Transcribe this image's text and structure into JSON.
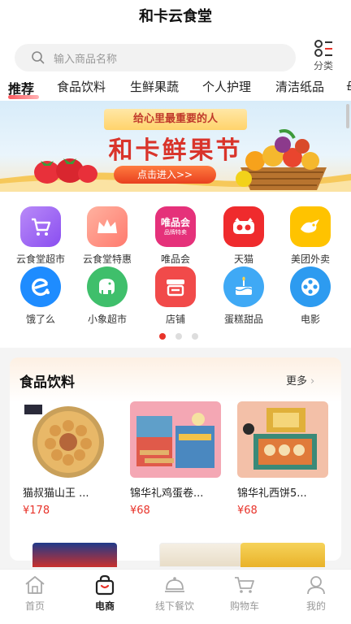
{
  "app": {
    "title": "和卡云食堂"
  },
  "search": {
    "placeholder": "输入商品名称",
    "category_label": "分类"
  },
  "tabs": [
    {
      "label": "推荐",
      "active": true
    },
    {
      "label": "食品饮料"
    },
    {
      "label": "生鲜果蔬"
    },
    {
      "label": "个人护理"
    },
    {
      "label": "清洁纸品"
    },
    {
      "label": "母"
    }
  ],
  "banner": {
    "ribbon_text": "给心里最重要的人",
    "heading": "和卡鲜果节",
    "cta_label": "点击进入>>"
  },
  "shortcuts": [
    {
      "label": "云食堂超市",
      "icon": "cart-icon",
      "color": "#9b5cf6"
    },
    {
      "label": "云食堂特惠",
      "icon": "crown-icon",
      "color": "#ff8a7a"
    },
    {
      "label": "唯品会",
      "icon": "vip-icon",
      "color": "#e5317a",
      "icon_text": "唯品会",
      "icon_sub": "品牌特卖"
    },
    {
      "label": "天猫",
      "icon": "tmall-icon",
      "color": "#ef2b2d"
    },
    {
      "label": "美团外卖",
      "icon": "meituan-icon",
      "color": "#ffc300"
    },
    {
      "label": "饿了么",
      "icon": "eleme-icon",
      "color": "#1e8cff"
    },
    {
      "label": "小象超市",
      "icon": "elephant-icon",
      "color": "#3fbf6b"
    },
    {
      "label": "店铺",
      "icon": "store-icon",
      "color": "#f14a4a"
    },
    {
      "label": "蛋糕甜品",
      "icon": "cake-icon",
      "color": "#3fa9f5"
    },
    {
      "label": "电影",
      "icon": "film-icon",
      "color": "#2d9bf0"
    }
  ],
  "carousel": {
    "page_count": 3,
    "active_index": 0
  },
  "section": {
    "title": "食品饮料",
    "more_label": "更多",
    "products": [
      {
        "name": "猫叔猫山王 ...",
        "price": "¥178"
      },
      {
        "name": "锦华礼鸡蛋卷...",
        "price": "¥68"
      },
      {
        "name": "锦华礼西饼5...",
        "price": "¥68"
      }
    ]
  },
  "bottom_nav": [
    {
      "label": "首页",
      "icon": "home-icon"
    },
    {
      "label": "电商",
      "icon": "shopping-bag-icon",
      "active": true
    },
    {
      "label": "线下餐饮",
      "icon": "dish-cover-icon"
    },
    {
      "label": "购物车",
      "icon": "cart-icon"
    },
    {
      "label": "我的",
      "icon": "user-icon"
    }
  ],
  "colors": {
    "accent": "#e8332a",
    "brand_red": "#d9342b"
  }
}
